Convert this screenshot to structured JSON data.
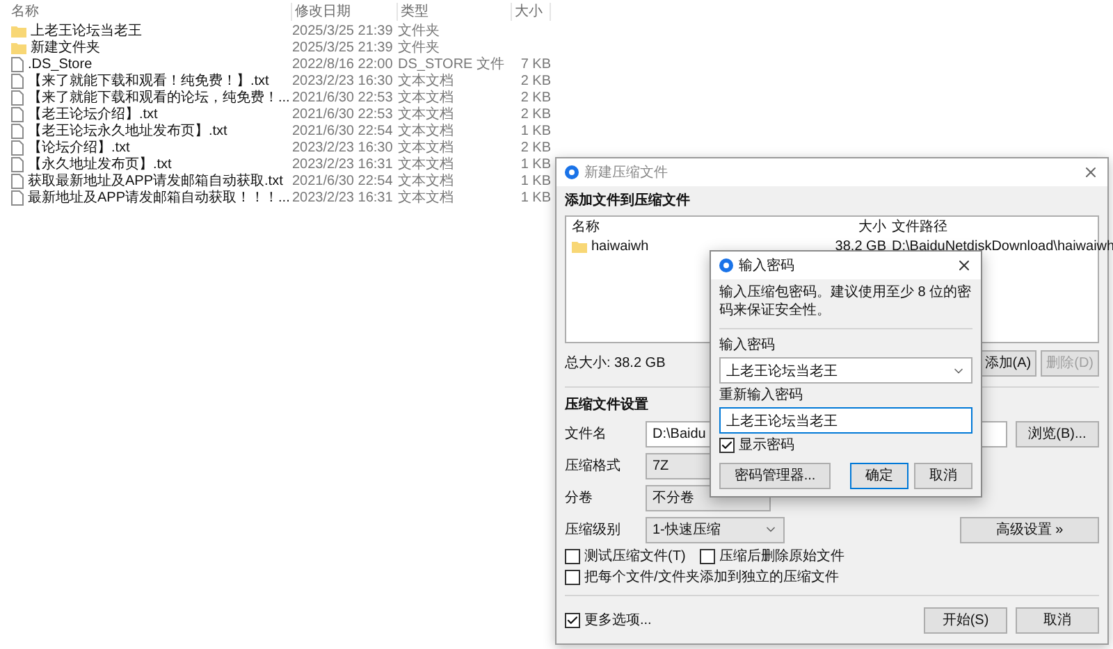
{
  "file_list": {
    "columns": [
      "名称",
      "修改日期",
      "类型",
      "大小"
    ],
    "rows": [
      {
        "kind": "folder",
        "name": "上老王论坛当老王",
        "modified": "2025/3/25 21:39",
        "type": "文件夹",
        "size": ""
      },
      {
        "kind": "folder",
        "name": "新建文件夹",
        "modified": "2025/3/25 21:39",
        "type": "文件夹",
        "size": ""
      },
      {
        "kind": "file",
        "name": ".DS_Store",
        "modified": "2022/8/16 22:00",
        "type": "DS_STORE 文件",
        "size": "7 KB"
      },
      {
        "kind": "file",
        "name": "【来了就能下载和观看！纯免费！】.txt",
        "modified": "2023/2/23 16:30",
        "type": "文本文档",
        "size": "2 KB"
      },
      {
        "kind": "file",
        "name": "【来了就能下载和观看的论坛，纯免费！...",
        "modified": "2021/6/30 22:53",
        "type": "文本文档",
        "size": "2 KB"
      },
      {
        "kind": "file",
        "name": "【老王论坛介绍】.txt",
        "modified": "2021/6/30 22:53",
        "type": "文本文档",
        "size": "2 KB"
      },
      {
        "kind": "file",
        "name": "【老王论坛永久地址发布页】.txt",
        "modified": "2021/6/30 22:54",
        "type": "文本文档",
        "size": "1 KB"
      },
      {
        "kind": "file",
        "name": "【论坛介绍】.txt",
        "modified": "2023/2/23 16:30",
        "type": "文本文档",
        "size": "2 KB"
      },
      {
        "kind": "file",
        "name": "【永久地址发布页】.txt",
        "modified": "2023/2/23 16:31",
        "type": "文本文档",
        "size": "1 KB"
      },
      {
        "kind": "file",
        "name": "获取最新地址及APP请发邮箱自动获取.txt",
        "modified": "2021/6/30 22:54",
        "type": "文本文档",
        "size": "1 KB"
      },
      {
        "kind": "file",
        "name": "最新地址及APP请发邮箱自动获取！！！...",
        "modified": "2023/2/23 16:31",
        "type": "文本文档",
        "size": "1 KB"
      }
    ]
  },
  "archive_dialog": {
    "title": "新建压缩文件",
    "files_section": "添加文件到压缩文件",
    "columns": [
      "名称",
      "大小",
      "文件路径"
    ],
    "files": [
      {
        "name": "haiwaiwh",
        "size": "38.2 GB",
        "path": "D:\\BaiduNetdiskDownload\\haiwaiwh"
      }
    ],
    "total": "总大小: 38.2 GB",
    "add_button": {
      "label": "添加(A)",
      "disabled": false
    },
    "delete_button": {
      "label": "删除(D)",
      "disabled": true
    },
    "settings_title": "压缩文件设置",
    "filename": {
      "label": "文件名",
      "value": "D:\\Baidu"
    },
    "browse_button": "浏览(B)...",
    "format": {
      "label": "压缩格式",
      "value": "7Z"
    },
    "split": {
      "label": "分卷",
      "value": "不分卷"
    },
    "level": {
      "label": "压缩级别",
      "value": "1-快速压缩"
    },
    "advanced_button": "高级设置 »",
    "options": [
      {
        "label": "测试压缩文件(T)",
        "checked": false
      },
      {
        "label": "压缩后删除原始文件",
        "checked": false
      },
      {
        "label": "把每个文件/文件夹添加到独立的压缩文件",
        "checked": false
      }
    ],
    "more_options": {
      "label": "更多选项...",
      "checked": true
    },
    "start_button": "开始(S)",
    "cancel_button": "取消"
  },
  "password_dialog": {
    "title": "输入密码",
    "message": "输入压缩包密码。建议使用至少 8 位的密码来保证安全性。",
    "password": {
      "label": "输入密码",
      "value": "上老王论坛当老王"
    },
    "confirm": {
      "label": "重新输入密码",
      "value": "上老王论坛当老王"
    },
    "show_password": {
      "label": "显示密码",
      "checked": true
    },
    "manager_button": "密码管理器...",
    "ok_button": "确定",
    "cancel_button": "取消"
  }
}
